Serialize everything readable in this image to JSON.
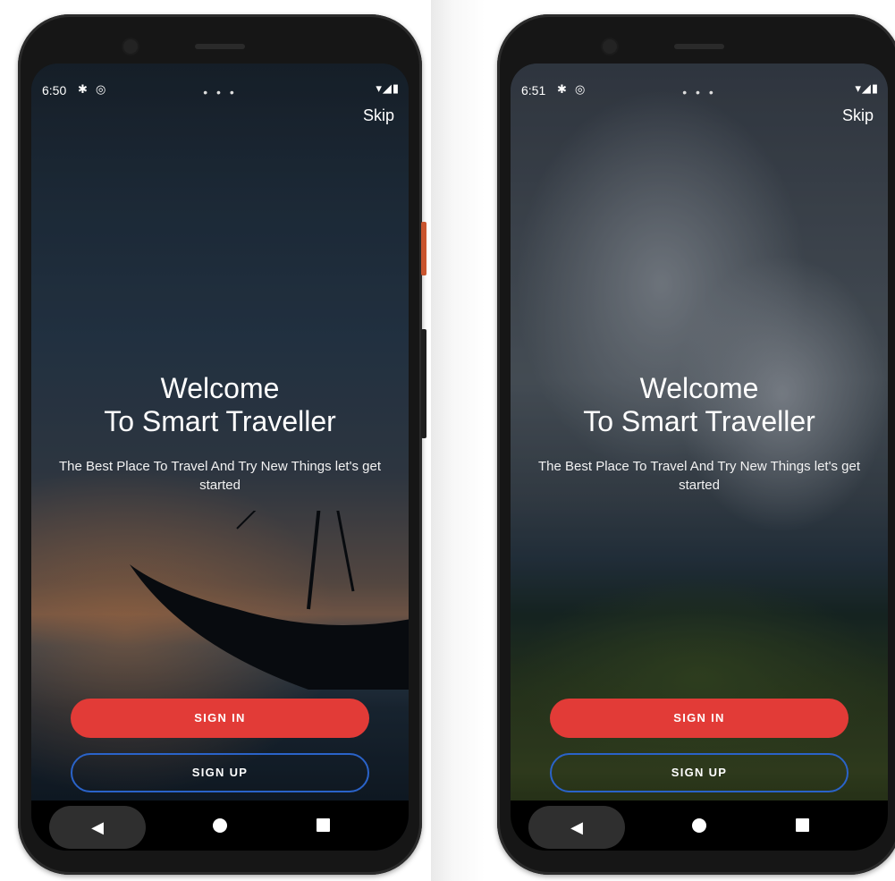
{
  "screens": [
    {
      "status": {
        "time": "6:50",
        "settings_icon": "gear-icon",
        "sync_icon": "sync-icon",
        "right_icons": "▾◢▮"
      },
      "page_dots": "• • •",
      "skip_label": "Skip",
      "title_line1": "Welcome",
      "title_line2": "To Smart Traveller",
      "subtitle": "The Best Place To Travel And Try New Things let's get started",
      "signin_label": "SIGN IN",
      "signup_label": "SIGN UP",
      "background": "boat at sunset on beach"
    },
    {
      "status": {
        "time": "6:51",
        "settings_icon": "gear-icon",
        "sync_icon": "sync-icon",
        "right_icons": "▾◢▮"
      },
      "page_dots": "• • •",
      "skip_label": "Skip",
      "title_line1": "Welcome",
      "title_line2": "To Smart Traveller",
      "subtitle": "The Best Place To Travel And Try New Things let's get started",
      "signin_label": "SIGN IN",
      "signup_label": "SIGN UP",
      "background": "clouds over green hills"
    }
  ],
  "colors": {
    "accent_red": "#e23b37",
    "signup_border": "#2a63c9",
    "nav_bar": "#000000"
  },
  "nav": {
    "back_glyph": "◀"
  }
}
